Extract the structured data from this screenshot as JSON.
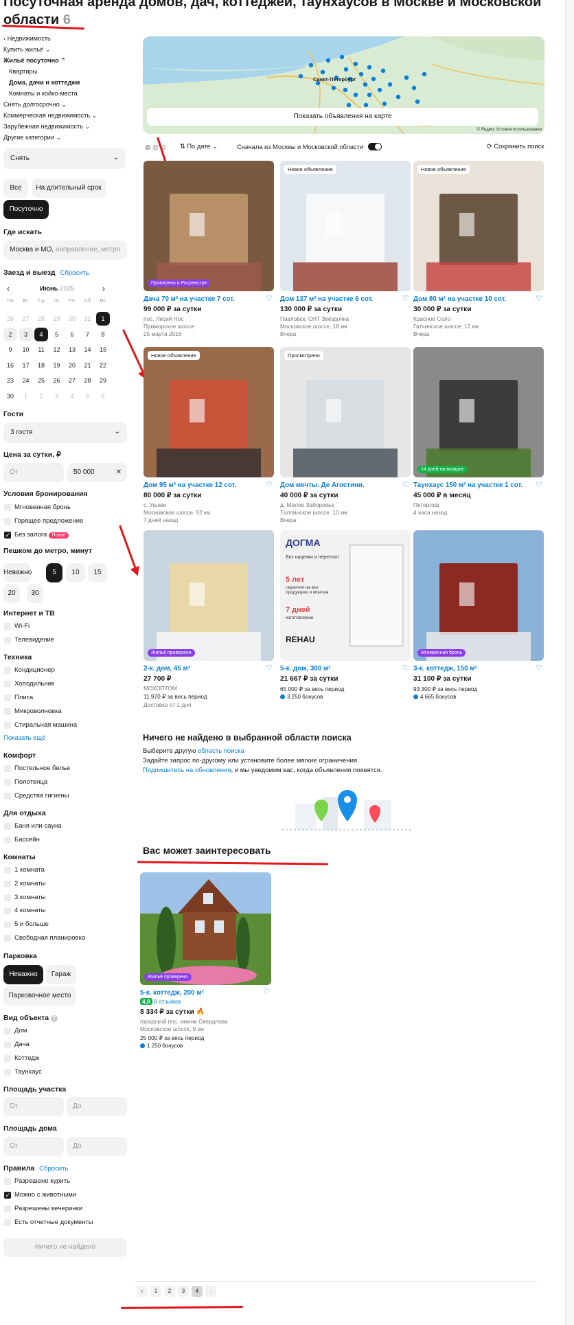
{
  "page": {
    "title": "Посуточная аренда домов, дач, коттеджей, таунхаусов в Москве и Московской области",
    "count": "6"
  },
  "sidebar": {
    "categories": [
      {
        "label": "‹ Недвижимость",
        "level": 0,
        "bold": false
      },
      {
        "label": "Купить жильё ⌄",
        "level": 0,
        "bold": false
      },
      {
        "label": "Жильё посуточно ⌃",
        "level": 0,
        "bold": true
      },
      {
        "label": "Квартиры",
        "level": 1,
        "bold": false
      },
      {
        "label": "Дома, дачи и коттеджи",
        "level": 1,
        "bold": true
      },
      {
        "label": "Комнаты и койко-места",
        "level": 1,
        "bold": false
      },
      {
        "label": "Снять долгосрочно ⌄",
        "level": 0,
        "bold": false
      },
      {
        "label": "Коммерческая недвижимость ⌄",
        "level": 0,
        "bold": false
      },
      {
        "label": "Зарубежная недвижимость ⌄",
        "level": 0,
        "bold": false
      },
      {
        "label": "Другие категории ⌄",
        "level": 0,
        "bold": false
      }
    ],
    "deal_select": "Снять",
    "term_all": "Все",
    "term_long": "На длительный срок",
    "term_daily": "Посуточно",
    "where_title": "Где искать",
    "where_value": "Москва и МО,",
    "where_placeholder": "направление, метро",
    "dates_title": "Заезд и выезд",
    "dates_reset": "Сбросить",
    "cal_month": "Июнь",
    "cal_year": "2025",
    "cal_weekdays": [
      "Пн",
      "Вт",
      "Ср",
      "Чт",
      "Пт",
      "Сб",
      "Вс"
    ],
    "cal_days": [
      "26",
      "27",
      "28",
      "29",
      "30",
      "31",
      "1",
      "2",
      "3",
      "4",
      "5",
      "6",
      "7",
      "8",
      "9",
      "10",
      "11",
      "12",
      "13",
      "14",
      "15",
      "16",
      "17",
      "18",
      "19",
      "20",
      "21",
      "22",
      "23",
      "24",
      "25",
      "26",
      "27",
      "28",
      "29",
      "30",
      "1",
      "2",
      "3",
      "4",
      "5",
      "6"
    ],
    "guests_title": "Гости",
    "guests_value": "3 гостя",
    "price_title": "Цена за сутки, ₽",
    "price_from": "От",
    "price_to": "50 000",
    "booking_title": "Условия бронирования",
    "booking_instant": "Мгновенная бронь",
    "booking_hot": "Горящее предложение",
    "booking_deposit": "Без залога",
    "new_badge": "Новое",
    "metro_title": "Пешком до метро, минут",
    "metro_opts": [
      "Неважно",
      "5",
      "10",
      "15",
      "20",
      "30"
    ],
    "internet_title": "Интернет и ТВ",
    "internet_opts": [
      "Wi-Fi",
      "Телевидение"
    ],
    "tech_title": "Техника",
    "tech_opts": [
      "Кондиционер",
      "Холодильник",
      "Плита",
      "Микроволновка",
      "Стиральная машина"
    ],
    "show_more": "Показать ещё",
    "comfort_title": "Комфорт",
    "comfort_opts": [
      "Постельное белье",
      "Полотенца",
      "Средства гигиены"
    ],
    "rest_title": "Для отдыха",
    "rest_opts": [
      "Баня или сауна",
      "Бассейн"
    ],
    "rooms_title": "Комнаты",
    "rooms_opts": [
      "1 комната",
      "2 комнаты",
      "3 комнаты",
      "4 комнаты",
      "5 и больше",
      "Свободная планировка"
    ],
    "parking_title": "Парковка",
    "parking_any": "Неважно",
    "parking_garage": "Гараж",
    "parking_place": "Парковочное место",
    "object_title": "Вид объекта",
    "object_opts": [
      "Дом",
      "Дача",
      "Коттедж",
      "Таунхаус"
    ],
    "plot_title": "Площадь участка",
    "house_area_title": "Площадь дома",
    "from": "От",
    "to": "До",
    "rules_title": "Правила",
    "rules_reset": "Сбросить",
    "rules_opts": [
      "Разрешено курить",
      "Можно с животными",
      "Разрешены вечеринки",
      "Есть отчетные документы"
    ],
    "submit": "Ничего не найдено"
  },
  "map": {
    "button": "Показать объявления на карте",
    "city_label": "Санкт-Петербург",
    "attribution": "© Яндекс  Условия использования",
    "brand": "Яндекс"
  },
  "toolbar": {
    "sort": "По дате",
    "moscow_first": "Сначала из Москвы и Московской области",
    "save_search": "Сохранить поиск"
  },
  "listings": [
    {
      "title": "Дача 70 м² на участке 7 сот.",
      "price": "99 000 ₽ за сутки",
      "geo": [
        "пос. Лисий Нос",
        "Приморское шоссе"
      ],
      "date": "25 марта 2016",
      "tag": "",
      "badge": "Проверено в Росреестре",
      "badge_color": "#8a3ee8"
    },
    {
      "title": "Дом 137 м² на участке 6 сот.",
      "price": "130 000 ₽ за сутки",
      "geo": [
        "Павловск, СНТ Звёздочка",
        "Московское шоссе, 18 км"
      ],
      "date": "Вчера",
      "tag": "Новое объявление",
      "badge": "",
      "badge_color": ""
    },
    {
      "title": "Дом 80 м² на участке 10 сот.",
      "price": "30 000 ₽ за сутки",
      "geo": [
        "Красное Село",
        "Гатчинское шоссе, 12 км"
      ],
      "date": "Вчера",
      "tag": "Новое объявление",
      "badge": "",
      "badge_color": ""
    },
    {
      "title": "Дом 95 м² на участке 12 сот.",
      "price": "80 000 ₽ за сутки",
      "geo": [
        "с. Ушаки",
        "Московское шоссе, 52 км"
      ],
      "date": "7 дней назад",
      "tag": "Новое объявление",
      "badge": "",
      "badge_color": ""
    },
    {
      "title": "Дом мечты. Де Агостини.",
      "price": "40 000 ₽ за сутки",
      "geo": [
        "д. Малое Заборовье",
        "Таллинское шоссе, 10 км"
      ],
      "date": "Вчера",
      "tag": "Просмотрено",
      "badge": "",
      "badge_color": ""
    },
    {
      "title": "Таунхаус 150 м² на участке 1 сот.",
      "price": "45 000 ₽ в месяц",
      "geo": [
        "Петергоф"
      ],
      "date": "4 часа назад",
      "tag": "",
      "badge": "14 дней на возврат",
      "badge_color": "#13b34a"
    },
    {
      "title": "2-к. дом, 45 м²",
      "price": "27 700 ₽",
      "geo": [
        "МОХОПТОМ"
      ],
      "sub": "11 970 ₽ за весь период",
      "date": "Доставка от 1 дня",
      "tag": "",
      "badge": "Жильё проверено",
      "badge_color": "#8a3ee8"
    },
    {
      "title": "5-к. дом, 300 м²",
      "price": "21 667 ₽ за сутки",
      "geo": [],
      "sub": "65 000 ₽ за весь период",
      "bonus": "3 250 бонусов",
      "date": "",
      "tag": "",
      "badge": "",
      "badge_color": ""
    },
    {
      "title": "3-к. коттедж, 150 м²",
      "price": "31 100 ₽ за сутки",
      "geo": [],
      "sub": "93 300 ₽ за весь период",
      "bonus": "4 665 бонусов",
      "date": "",
      "tag": "",
      "badge": "Мгновенная бронь",
      "badge_color": "#8a3ee8"
    }
  ],
  "ad": {
    "brand": "ДОГМА",
    "l1": "Без наценки и переплат",
    "l2": "5 лет",
    "l2b": "гарантия на все продукцию и монтаж",
    "l3": "7 дней",
    "l3b": "изготовление",
    "rehau": "REHAU"
  },
  "empty": {
    "title": "Ничего не найдено в выбранной области поиска",
    "line1_a": "Выберите другую",
    "line1_link": "область поиска",
    "line2": "Задайте запрос по-другому или установите более мягкие ограничения.",
    "line3_link": "Подпишитесь на обновления",
    "line3_b": ", и мы уведомим вас, когда объявления появятся."
  },
  "recommend": {
    "title": "Вас может заинтересовать",
    "card": {
      "badge": "Жильё проверено",
      "title": "5-к. коттедж, 200 м²",
      "rating": "4,8",
      "reviews": "8 отзывов",
      "price": "8 334 ₽ за сутки",
      "geo1": "городской пос. имени Свердлова",
      "geo2": "Московское шоссе, 9 км",
      "sub": "25 000 ₽ за весь период",
      "bonus": "1 250 бонусов"
    }
  },
  "pagination": [
    "‹",
    "1",
    "2",
    "3",
    "4",
    "›"
  ],
  "colors": {
    "accent": "#0a7fd8",
    "annotation": "#e0161b",
    "badge_purple": "#8a3ee8",
    "badge_green": "#13b34a"
  }
}
